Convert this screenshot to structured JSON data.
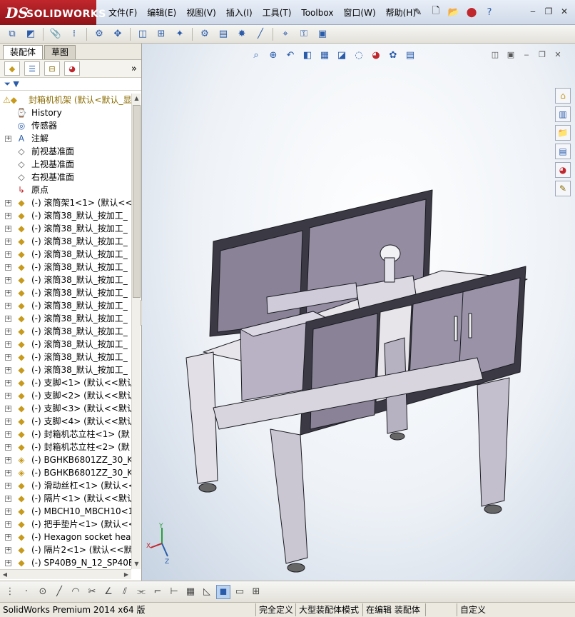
{
  "titlebar": {
    "logo_ds": "DS",
    "logo_text": "SOLIDWORKS",
    "menus": [
      "文件(F)",
      "编辑(E)",
      "视图(V)",
      "插入(I)",
      "工具(T)",
      "Toolbox",
      "窗口(W)",
      "帮助(H)"
    ],
    "tools": [
      "new-icon",
      "open-icon",
      "traffic-light-icon",
      "help-icon"
    ],
    "window_controls": [
      "minimize-icon",
      "restore-icon",
      "close-icon"
    ]
  },
  "panel": {
    "tabs": [
      {
        "label": "装配体",
        "active": true
      },
      {
        "label": "草图",
        "active": false
      }
    ],
    "filter_symbol": "▼"
  },
  "tree": {
    "root": {
      "icon": "assembly-icon",
      "label": "封箱机机架  (默认<默认_显"
    },
    "items": [
      {
        "label": "History",
        "icon": "history-icon"
      },
      {
        "label": "传感器",
        "icon": "sensor-icon"
      },
      {
        "label": "注解",
        "icon": "annotation-icon"
      },
      {
        "label": "前视基准面",
        "icon": "plane-icon"
      },
      {
        "label": "上视基准面",
        "icon": "plane-icon"
      },
      {
        "label": "右视基准面",
        "icon": "plane-icon"
      },
      {
        "label": "原点",
        "icon": "origin-icon"
      },
      {
        "label": "(-) 滚筒架1<1> (默认<<默",
        "icon": "part-icon"
      },
      {
        "label": "(-) 滚筒38_默认_按加工_",
        "icon": "part-icon"
      },
      {
        "label": "(-) 滚筒38_默认_按加工_",
        "icon": "part-icon"
      },
      {
        "label": "(-) 滚筒38_默认_按加工_",
        "icon": "part-icon"
      },
      {
        "label": "(-) 滚筒38_默认_按加工_",
        "icon": "part-icon"
      },
      {
        "label": "(-) 滚筒38_默认_按加工_",
        "icon": "part-icon"
      },
      {
        "label": "(-) 滚筒38_默认_按加工_",
        "icon": "part-icon"
      },
      {
        "label": "(-) 滚筒38_默认_按加工_",
        "icon": "part-icon"
      },
      {
        "label": "(-) 滚筒38_默认_按加工_",
        "icon": "part-icon"
      },
      {
        "label": "(-) 滚筒38_默认_按加工_",
        "icon": "part-icon"
      },
      {
        "label": "(-) 滚筒38_默认_按加工_",
        "icon": "part-icon"
      },
      {
        "label": "(-) 滚筒38_默认_按加工_",
        "icon": "part-icon"
      },
      {
        "label": "(-) 滚筒38_默认_按加工_",
        "icon": "part-icon"
      },
      {
        "label": "(-) 滚筒38_默认_按加工_",
        "icon": "part-icon"
      },
      {
        "label": "(-) 支脚<1> (默认<<默认",
        "icon": "part-icon"
      },
      {
        "label": "(-) 支脚<2> (默认<<默认",
        "icon": "part-icon"
      },
      {
        "label": "(-) 支脚<3> (默认<<默认",
        "icon": "part-icon"
      },
      {
        "label": "(-) 支脚<4> (默认<<默认",
        "icon": "part-icon"
      },
      {
        "label": "(-) 封箱机芯立柱<1> (默",
        "icon": "part-icon"
      },
      {
        "label": "(-) 封箱机芯立柱<2> (默",
        "icon": "part-icon"
      },
      {
        "label": "(-) BGHKB6801ZZ_30_KCC_",
        "icon": "subassembly-icon"
      },
      {
        "label": "(-) BGHKB6801ZZ_30_KCC_",
        "icon": "subassembly-icon"
      },
      {
        "label": "(-) 滑动丝杠<1> (默认<<",
        "icon": "part-icon"
      },
      {
        "label": "(-) 隔片<1> (默认<<默认",
        "icon": "part-icon"
      },
      {
        "label": "(-) MBCH10_MBCH10<1> (默",
        "icon": "part-icon"
      },
      {
        "label": "(-) 把手垫片<1> (默认<<",
        "icon": "part-icon"
      },
      {
        "label": "(-) Hexagon socket head",
        "icon": "part-icon"
      },
      {
        "label": "(-) 隔片2<1> (默认<<默认",
        "icon": "part-icon"
      },
      {
        "label": "(-) SP40B9_N_12_SP40B9-",
        "icon": "part-icon"
      }
    ]
  },
  "graphics": {
    "triad_labels": {
      "x": "X",
      "y": "Y",
      "z": "Z"
    }
  },
  "status": {
    "app_name": "SolidWorks Premium 2014 x64 版",
    "fields": [
      "完全定义",
      "大型装配体模式",
      "在编辑 装配体",
      "自定义"
    ]
  }
}
